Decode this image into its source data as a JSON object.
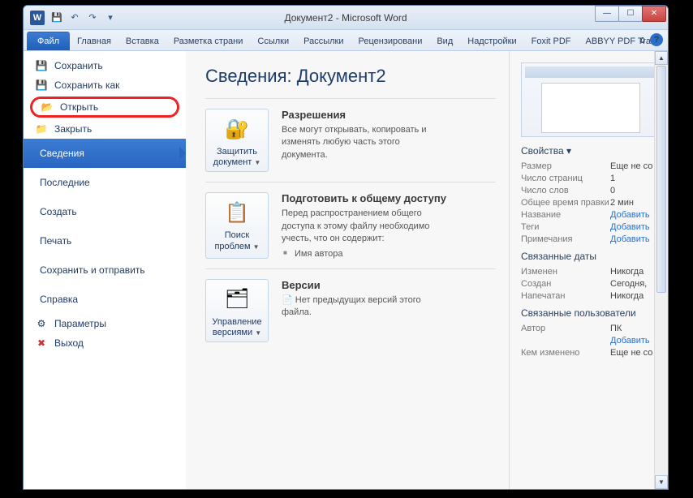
{
  "title": "Документ2 - Microsoft Word",
  "app_icon": "W",
  "tabs": {
    "file": "Файл",
    "home": "Главная",
    "insert": "Вставка",
    "layout": "Разметка страни",
    "refs": "Ссылки",
    "mail": "Рассылки",
    "review": "Рецензировани",
    "view": "Вид",
    "addins": "Надстройки",
    "foxit": "Foxit PDF",
    "abbyy": "ABBYY PDF Trans"
  },
  "sidebar": {
    "save": "Сохранить",
    "save_as": "Сохранить как",
    "open": "Открыть",
    "close": "Закрыть",
    "info": "Сведения",
    "recent": "Последние",
    "new": "Создать",
    "print": "Печать",
    "send": "Сохранить и отправить",
    "help": "Справка",
    "options": "Параметры",
    "exit": "Выход"
  },
  "info": {
    "heading": "Сведения: Документ2",
    "protect_btn": "Защитить документ",
    "perms_title": "Разрешения",
    "perms_text": "Все могут открывать, копировать и изменять любую часть этого документа.",
    "check_btn": "Поиск проблем",
    "prep_title": "Подготовить к общему доступу",
    "prep_text": "Перед распространением общего доступа к этому файлу необходимо учесть, что он содержит:",
    "prep_bullet": "Имя автора",
    "versions_btn": "Управление версиями",
    "ver_title": "Версии",
    "ver_text": "Нет предыдущих версий этого файла."
  },
  "props": {
    "heading": "Свойства",
    "size_k": "Размер",
    "size_v": "Еще не со",
    "pages_k": "Число страниц",
    "pages_v": "1",
    "words_k": "Число слов",
    "words_v": "0",
    "time_k": "Общее время правки",
    "time_v": "2 мин",
    "title_k": "Название",
    "title_v": "Добавить",
    "tags_k": "Теги",
    "tags_v": "Добавить",
    "comments_k": "Примечания",
    "comments_v": "Добавить",
    "dates_heading": "Связанные даты",
    "modified_k": "Изменен",
    "modified_v": "Никогда",
    "created_k": "Создан",
    "created_v": "Сегодня,",
    "printed_k": "Напечатан",
    "printed_v": "Никогда",
    "people_heading": "Связанные пользователи",
    "author_k": "Автор",
    "author_v": "ПК",
    "add_author": "Добавить",
    "lastmod_k": "Кем изменено",
    "lastmod_v": "Еще не со"
  }
}
